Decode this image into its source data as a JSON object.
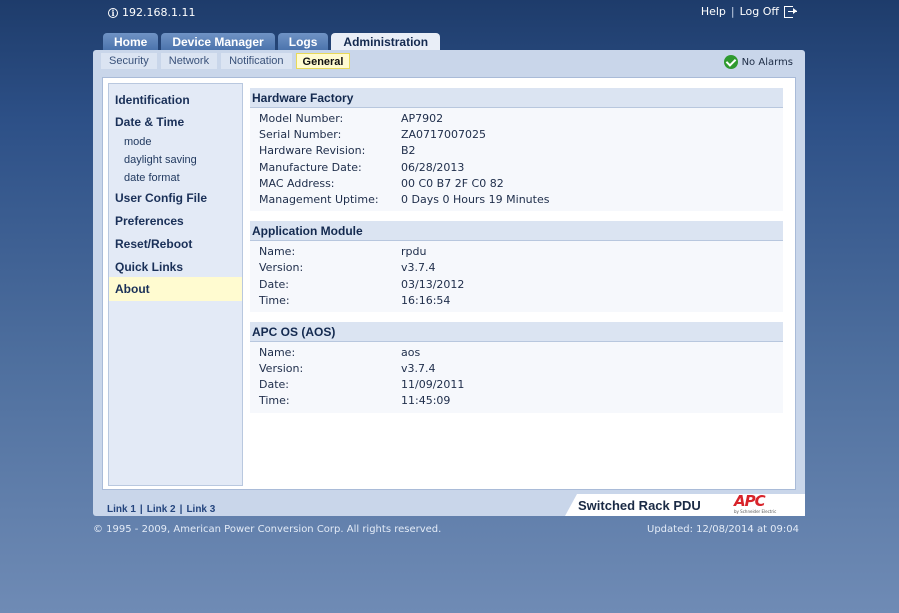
{
  "header": {
    "ip": "192.168.1.11",
    "help": "Help",
    "separator": "|",
    "logoff": "Log Off"
  },
  "tabs": [
    {
      "label": "Home"
    },
    {
      "label": "Device Manager"
    },
    {
      "label": "Logs"
    },
    {
      "label": "Administration"
    }
  ],
  "subtabs": [
    {
      "label": "Security"
    },
    {
      "label": "Network"
    },
    {
      "label": "Notification"
    },
    {
      "label": "General"
    }
  ],
  "alarm": {
    "text": "No Alarms"
  },
  "leftnav": {
    "identification": "Identification",
    "date_time": "Date & Time",
    "mode": "mode",
    "daylight": "daylight saving",
    "date_format": "date format",
    "user_config": "User Config File",
    "preferences": "Preferences",
    "reset": "Reset/Reboot",
    "quick_links": "Quick Links",
    "about": "About"
  },
  "sections": {
    "hardware": {
      "title": "Hardware Factory",
      "rows": [
        {
          "k": "Model Number:",
          "v": "AP7902"
        },
        {
          "k": "Serial Number:",
          "v": "ZA0717007025"
        },
        {
          "k": "Hardware Revision:",
          "v": "B2"
        },
        {
          "k": "Manufacture Date:",
          "v": "06/28/2013"
        },
        {
          "k": "MAC Address:",
          "v": "00 C0 B7 2F C0 82"
        },
        {
          "k": "Management Uptime:",
          "v": "0 Days 0 Hours 19 Minutes"
        }
      ]
    },
    "app": {
      "title": "Application Module",
      "rows": [
        {
          "k": "Name:",
          "v": "rpdu"
        },
        {
          "k": "Version:",
          "v": "v3.7.4"
        },
        {
          "k": "Date:",
          "v": "03/13/2012"
        },
        {
          "k": "Time:",
          "v": "16:16:54"
        }
      ]
    },
    "aos": {
      "title": "APC OS (AOS)",
      "rows": [
        {
          "k": "Name:",
          "v": "aos"
        },
        {
          "k": "Version:",
          "v": "v3.7.4"
        },
        {
          "k": "Date:",
          "v": "11/09/2011"
        },
        {
          "k": "Time:",
          "v": "11:45:09"
        }
      ]
    }
  },
  "footer": {
    "link1": "Link 1",
    "link2": "Link 2",
    "link3": "Link 3",
    "sep": "|",
    "product": "Switched Rack PDU",
    "logo_text": "APC",
    "logo_sub": "by Schneider Electric",
    "copyright": "© 1995 - 2009, American Power Conversion Corp. All rights reserved.",
    "updated": "Updated: 12/08/2014 at 09:04"
  }
}
